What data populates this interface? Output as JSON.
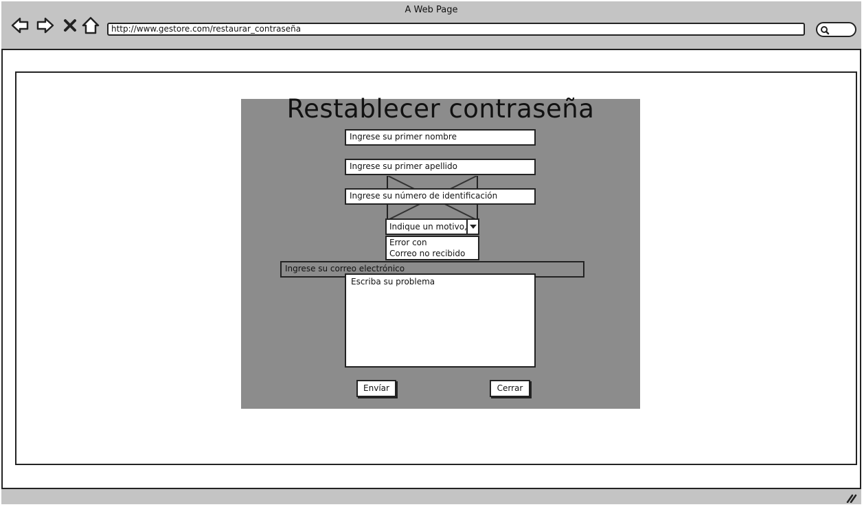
{
  "window": {
    "title": "A Web Page",
    "url": "http://www.gestore.com/restaurar_contraseña"
  },
  "icons": [
    "back-arrow-icon",
    "forward-arrow-icon",
    "close-x-icon",
    "home-icon",
    "search-icon",
    "resize-grip-icon"
  ],
  "form": {
    "title": "Restablecer contraseña",
    "first_name_placeholder": "Ingrese su primer nombre",
    "last_name_placeholder": "Ingrese su primer apellido",
    "id_number_placeholder": "Ingrese su número de identificación",
    "reason_select": {
      "selected": "Indique un motivo,",
      "options": [
        "Error con",
        "Correo no recibido"
      ]
    },
    "email_placeholder": "Ingrese su correo electrónico",
    "problem_placeholder": "Escriba su problema",
    "submit_label": "Envíar",
    "close_label": "Cerrar"
  },
  "colors": {
    "chrome": "#c4c4c4",
    "panel": "#8c8c8c",
    "ink": "#222222"
  }
}
